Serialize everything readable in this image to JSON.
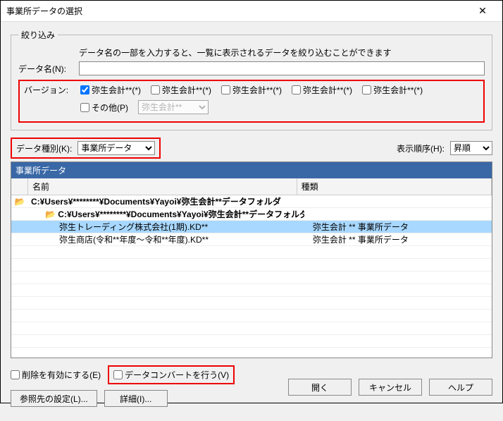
{
  "window": {
    "title": "事業所データの選択",
    "close": "✕"
  },
  "filter": {
    "legend": "絞り込み",
    "hint": "データ名の一部を入力すると、一覧に表示されるデータを絞り込むことができます",
    "dataname_label": "データ名(N):",
    "dataname_value": "",
    "version_label": "バージョン:",
    "versions": [
      {
        "label": "弥生会計**(*)",
        "checked": true
      },
      {
        "label": "弥生会計**(*)",
        "checked": false
      },
      {
        "label": "弥生会計**(*)",
        "checked": false
      },
      {
        "label": "弥生会計**(*)",
        "checked": false
      },
      {
        "label": "弥生会計**(*)",
        "checked": false
      }
    ],
    "other_label": "その他(P)",
    "other_checked": false,
    "other_select_value": "弥生会計**"
  },
  "mid": {
    "datakind_label": "データ種別(K):",
    "datakind_value": "事業所データ",
    "order_label": "表示順序(H):",
    "order_value": "昇順"
  },
  "table": {
    "title": "事業所データ",
    "columns": {
      "name": "名前",
      "kind": "種類"
    },
    "rows": [
      {
        "type": "folder",
        "indent": 0,
        "name": "C:¥Users¥********¥Documents¥Yayoi¥弥生会計**データフォルダ",
        "kind": ""
      },
      {
        "type": "folder",
        "indent": 1,
        "name": "C:¥Users¥********¥Documents¥Yayoi¥弥生会計**データフォルダ",
        "kind": ""
      },
      {
        "type": "file",
        "indent": 2,
        "name": "弥生トレーディング株式会社(1期).KD**",
        "kind": "弥生会計 ** 事業所データ",
        "selected": true
      },
      {
        "type": "file",
        "indent": 2,
        "name": "弥生商店(令和**年度～令和**年度).KD**",
        "kind": "弥生会計 ** 事業所データ"
      }
    ]
  },
  "bottom": {
    "delete_enable_label": "削除を有効にする(E)",
    "convert_label": "データコンバートを行う(V)",
    "ref_settings": "参照先の設定(L)...",
    "details": "詳細(I)..."
  },
  "footer": {
    "open": "開く",
    "cancel": "キャンセル",
    "help": "ヘルプ"
  }
}
